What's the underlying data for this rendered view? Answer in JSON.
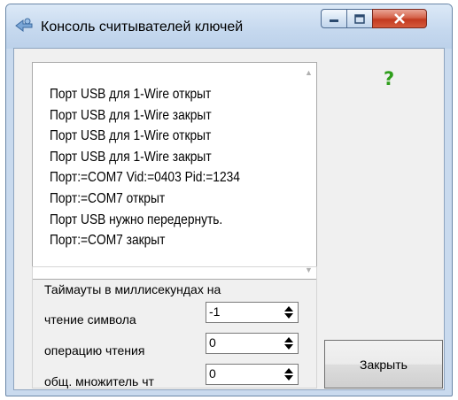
{
  "window": {
    "title": "Консоль считывателей ключей",
    "icons": [
      "app-icon",
      "minimize-icon",
      "maximize-icon",
      "close-icon"
    ]
  },
  "log": {
    "lines": [
      "Порт USB для 1-Wire открыт",
      "Порт USB для 1-Wire закрыт",
      "Порт USB для 1-Wire открыт",
      "Порт USB для 1-Wire закрыт",
      "Порт:=COM7 Vid:=0403 Pid:=1234",
      "Порт:=COM7 открыт",
      "Порт USB нужно передернуть.",
      "Порт:=COM7 закрыт"
    ]
  },
  "help": {
    "symbol": "?"
  },
  "timeouts": {
    "title": "Таймауты в миллисекундах на",
    "rows": [
      {
        "label": "чтение символа",
        "value": "-1"
      },
      {
        "label": "операцию чтения",
        "value": "0"
      },
      {
        "label": "общ. множитель чт",
        "value": "0"
      }
    ]
  },
  "buttons": {
    "close_label": "Закрыть"
  },
  "colors": {
    "title_bar": "#c9daee",
    "close_button": "#c33a20",
    "help_icon": "#2f9e1c"
  }
}
